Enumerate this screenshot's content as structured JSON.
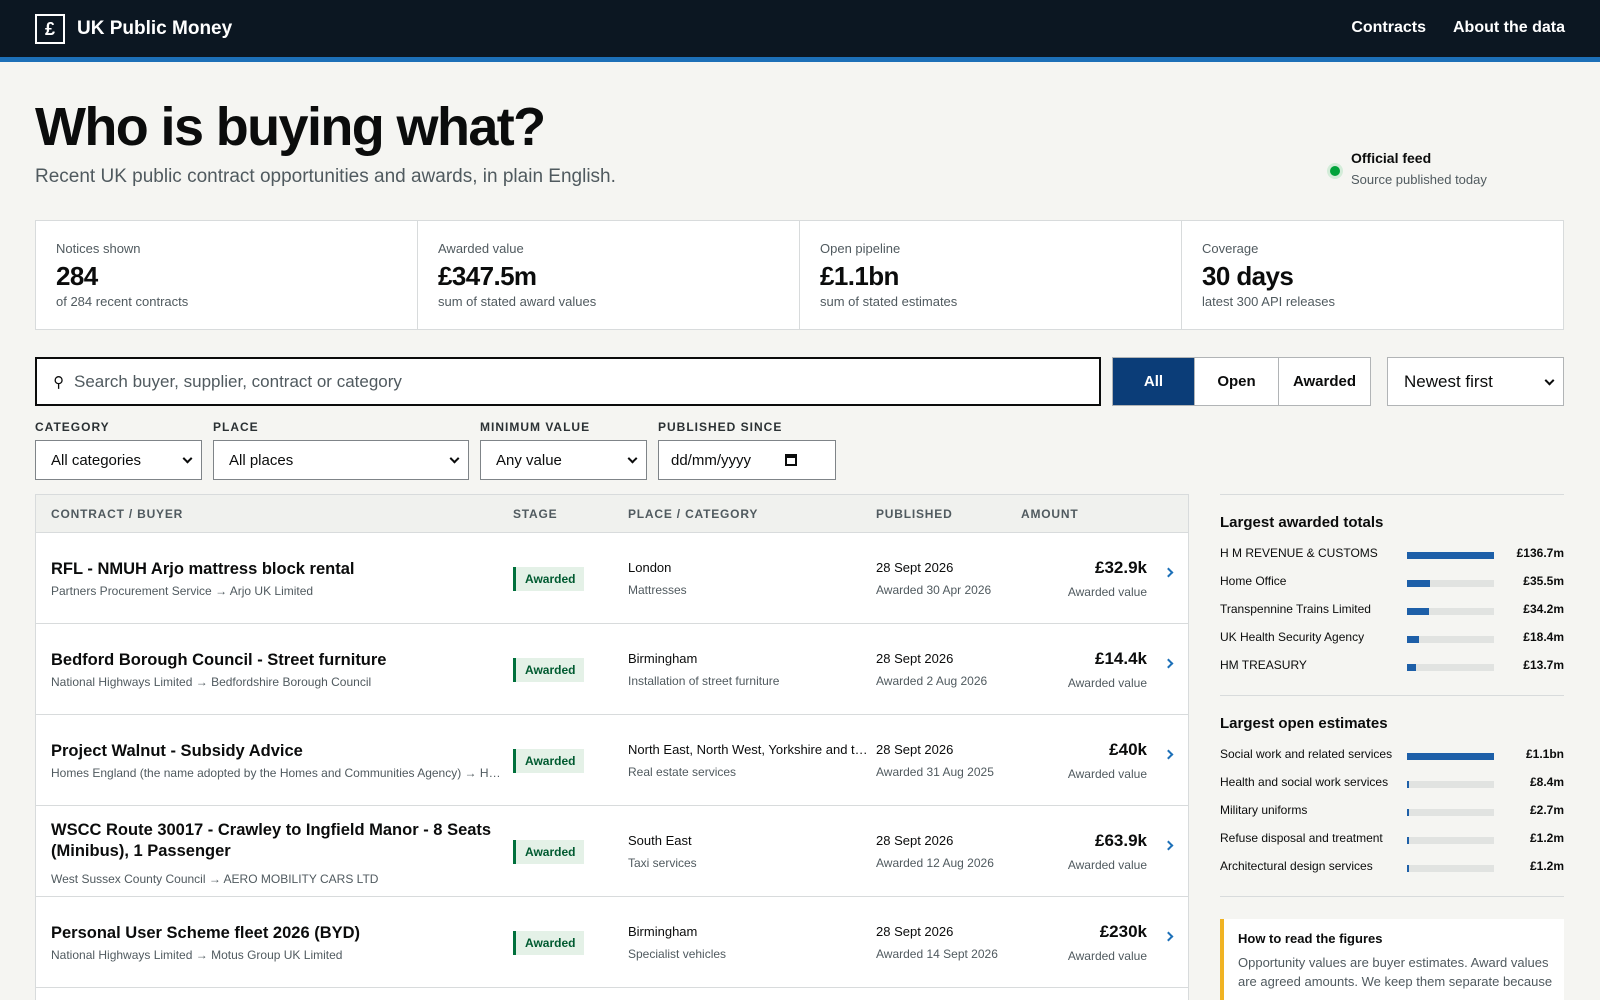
{
  "header": {
    "logo_glyph": "£",
    "title": "UK Public Money",
    "nav": [
      "Contracts",
      "About the data"
    ]
  },
  "hero": {
    "title": "Who is buying what?",
    "subtitle": "Recent UK public contract opportunities and awards, in plain English."
  },
  "feed": {
    "title": "Official feed",
    "subtitle": "Source published today",
    "status_color": "#00a33b"
  },
  "stats": [
    {
      "label": "Notices shown",
      "value": "284",
      "sub": "of 284 recent contracts"
    },
    {
      "label": "Awarded value",
      "value": "£347.5m",
      "sub": "sum of stated award values"
    },
    {
      "label": "Open pipeline",
      "value": "£1.1bn",
      "sub": "sum of stated estimates"
    },
    {
      "label": "Coverage",
      "value": "30 days",
      "sub": "latest 300 API releases"
    }
  ],
  "search": {
    "icon": "search-icon",
    "placeholder": "Search buyer, supplier, contract or category"
  },
  "stage_filter": {
    "options": [
      "All",
      "Open",
      "Awarded"
    ],
    "selected": "All"
  },
  "sort": {
    "selected": "Newest first"
  },
  "filters": {
    "category": {
      "label": "CATEGORY",
      "value": "All categories"
    },
    "place": {
      "label": "PLACE",
      "value": "All places"
    },
    "min_value": {
      "label": "MINIMUM VALUE",
      "value": "Any value"
    },
    "published_since": {
      "label": "PUBLISHED SINCE",
      "placeholder": "dd/mm/yyyy"
    }
  },
  "table": {
    "columns": [
      "CONTRACT / BUYER",
      "STAGE",
      "PLACE / CATEGORY",
      "PUBLISHED",
      "AMOUNT"
    ],
    "rows": [
      {
        "title": "RFL - NMUH Arjo mattress block rental",
        "buyer": "Partners Procurement Service → Arjo UK Limited",
        "stage": "Awarded",
        "place": "London",
        "category": "Mattresses",
        "published": "28 Sept 2026",
        "awarded": "Awarded 30 Apr 2026",
        "amount": "£32.9k",
        "amount_label": "Awarded value"
      },
      {
        "title": "Bedford Borough Council - Street furniture",
        "buyer": "National Highways Limited → Bedfordshire Borough Council",
        "stage": "Awarded",
        "place": "Birmingham",
        "category": "Installation of street furniture",
        "published": "28 Sept 2026",
        "awarded": "Awarded 2 Aug 2026",
        "amount": "£14.4k",
        "amount_label": "Awarded value"
      },
      {
        "title": "Project Walnut - Subsidy Advice",
        "buyer": "Homes England (the name adopted by the Homes and Communities Agency) → Homes England",
        "stage": "Awarded",
        "place": "North East, North West, Yorkshire and the Humber",
        "category": "Real estate services",
        "published": "28 Sept 2026",
        "awarded": "Awarded 31 Aug 2025",
        "amount": "£40k",
        "amount_label": "Awarded value"
      },
      {
        "title": "WSCC Route 30017 - Crawley to Ingfield Manor - 8 Seats (Minibus), 1 Passenger",
        "buyer": "West Sussex County Council → AERO MOBILITY CARS LTD",
        "stage": "Awarded",
        "place": "South East",
        "category": "Taxi services",
        "published": "28 Sept 2026",
        "awarded": "Awarded 12 Aug 2026",
        "amount": "£63.9k",
        "amount_label": "Awarded value"
      },
      {
        "title": "Personal User Scheme fleet 2026 (BYD)",
        "buyer": "National Highways Limited → Motus Group UK Limited",
        "stage": "Awarded",
        "place": "Birmingham",
        "category": "Specialist vehicles",
        "published": "28 Sept 2026",
        "awarded": "Awarded 14 Sept 2026",
        "amount": "£230k",
        "amount_label": "Awarded value"
      }
    ]
  },
  "sidebar": {
    "awarded": {
      "title": "Largest awarded totals",
      "items": [
        {
          "label": "H M REVENUE & CUSTOMS",
          "value": "£136.7m",
          "amount": 136.7
        },
        {
          "label": "Home Office",
          "value": "£35.5m",
          "amount": 35.5
        },
        {
          "label": "Transpennine Trains Limited",
          "value": "£34.2m",
          "amount": 34.2
        },
        {
          "label": "UK Health Security Agency",
          "value": "£18.4m",
          "amount": 18.4
        },
        {
          "label": "HM TREASURY",
          "value": "£13.7m",
          "amount": 13.7
        }
      ]
    },
    "open": {
      "title": "Largest open estimates",
      "items": [
        {
          "label": "Social work and related services",
          "value": "£1.1bn",
          "amount": 1100
        },
        {
          "label": "Health and social work services",
          "value": "£8.4m",
          "amount": 8.4
        },
        {
          "label": "Military uniforms",
          "value": "£2.7m",
          "amount": 2.7
        },
        {
          "label": "Refuse disposal and treatment",
          "value": "£1.2m",
          "amount": 1.2
        },
        {
          "label": "Architectural design services",
          "value": "£1.2m",
          "amount": 1.2
        }
      ]
    },
    "note": {
      "title": "How to read the figures",
      "body": "Opportunity values are buyer estimates. Award values are agreed amounts. We keep them separate because"
    }
  },
  "colors": {
    "header_bg": "#0c1722",
    "accent": "#1d70b8",
    "active_segment": "#0b3d78",
    "badge_green": "#00703c",
    "note_border": "#f0b323"
  }
}
